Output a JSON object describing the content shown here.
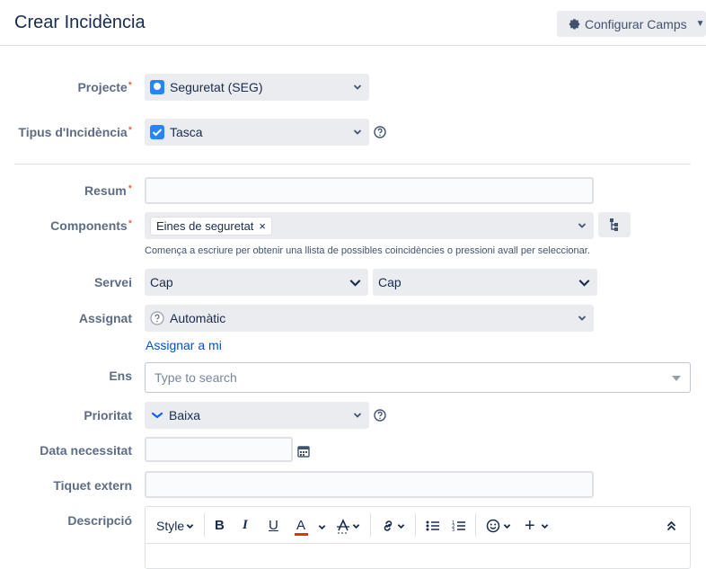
{
  "header": {
    "title": "Crear Incidència",
    "config_button": "Configurar Camps"
  },
  "fields": {
    "project": {
      "label": "Projecte",
      "required": "*",
      "value": "Seguretat (SEG)"
    },
    "issue_type": {
      "label": "Tipus d'Incidència",
      "required": "*",
      "value": "Tasca"
    },
    "summary": {
      "label": "Resum",
      "required": "*",
      "value": ""
    },
    "components": {
      "label": "Components",
      "required": "*",
      "chip": "Eines de seguretat",
      "chip_remove": "×",
      "hint": "Comença a escriure per obtenir una llista de possibles coincidències o pressioni avall per seleccionar."
    },
    "service": {
      "label": "Servei",
      "value1": "Cap",
      "value2": "Cap"
    },
    "assignee": {
      "label": "Assignat",
      "value": "Automàtic",
      "assign_to_me": "Assignar a mi"
    },
    "ens": {
      "label": "Ens",
      "placeholder": "Type to search"
    },
    "priority": {
      "label": "Prioritat",
      "value": "Baixa"
    },
    "date": {
      "label": "Data necessitat",
      "value": ""
    },
    "external_ticket": {
      "label": "Tiquet extern",
      "value": ""
    },
    "description": {
      "label": "Descripció"
    }
  },
  "toolbar": {
    "style": "Style",
    "bold": "B",
    "italic": "I",
    "underline": "U",
    "text_color": "A",
    "plus": "+"
  },
  "colors": {
    "accent": "#0052cc",
    "required": "#de350b",
    "text_color_bar": "#de350b"
  }
}
